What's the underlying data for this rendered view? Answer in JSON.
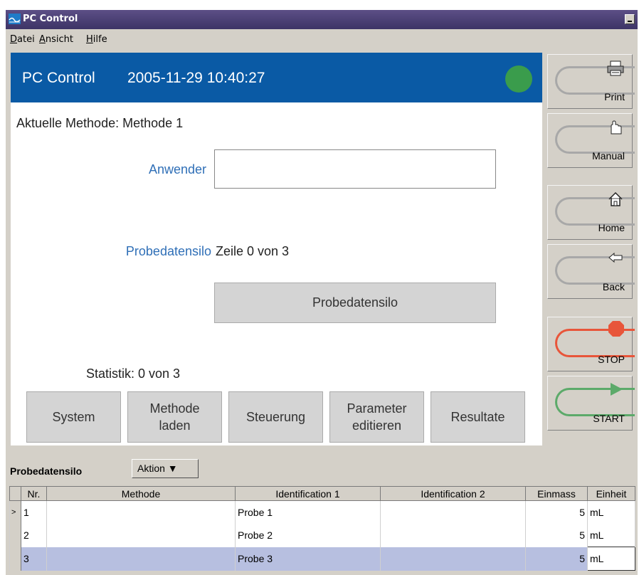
{
  "window": {
    "title": "PC Control"
  },
  "menu": [
    "Datei",
    "Ansicht",
    "Hilfe"
  ],
  "header": {
    "app": "PC Control",
    "datetime": "2005-11-29 10:40:27",
    "status_color": "#3a9c4c"
  },
  "main": {
    "current_method": "Aktuelle Methode: Methode 1",
    "user_label": "Anwender",
    "user_value": "",
    "silo_label": "Probedatensilo",
    "silo_status": "Zeile 0 von 3",
    "silo_button": "Probedatensilo",
    "statistics": "Statistik: 0 von 3"
  },
  "nav_buttons": [
    "System",
    "Methode\nladen",
    "Steuerung",
    "Parameter\neditieren",
    "Resultate"
  ],
  "side_buttons": {
    "print": "Print",
    "manual": "Manual",
    "home": "Home",
    "back": "Back",
    "stop": "STOP",
    "start": "START"
  },
  "colors": {
    "stop": "#e8553a",
    "start": "#5caa6a",
    "header_bg": "#0a5aa5",
    "selected_row": "#b7bfe0"
  },
  "panel": {
    "title": "Probedatensilo",
    "action_label": "Aktion ▼",
    "columns": [
      "Nr.",
      "Methode",
      "Identification 1",
      "Identification 2",
      "Einmass",
      "Einheit"
    ],
    "rows": [
      {
        "marker": ">",
        "nr": "1",
        "methode": "",
        "id1": "Probe 1",
        "id2": "",
        "einmass": "5",
        "einheit": "mL"
      },
      {
        "marker": "",
        "nr": "2",
        "methode": "",
        "id1": "Probe 2",
        "id2": "",
        "einmass": "5",
        "einheit": "mL"
      },
      {
        "marker": "",
        "nr": "3",
        "methode": "",
        "id1": "Probe 3",
        "id2": "",
        "einmass": "5",
        "einheit": "mL"
      }
    ]
  }
}
